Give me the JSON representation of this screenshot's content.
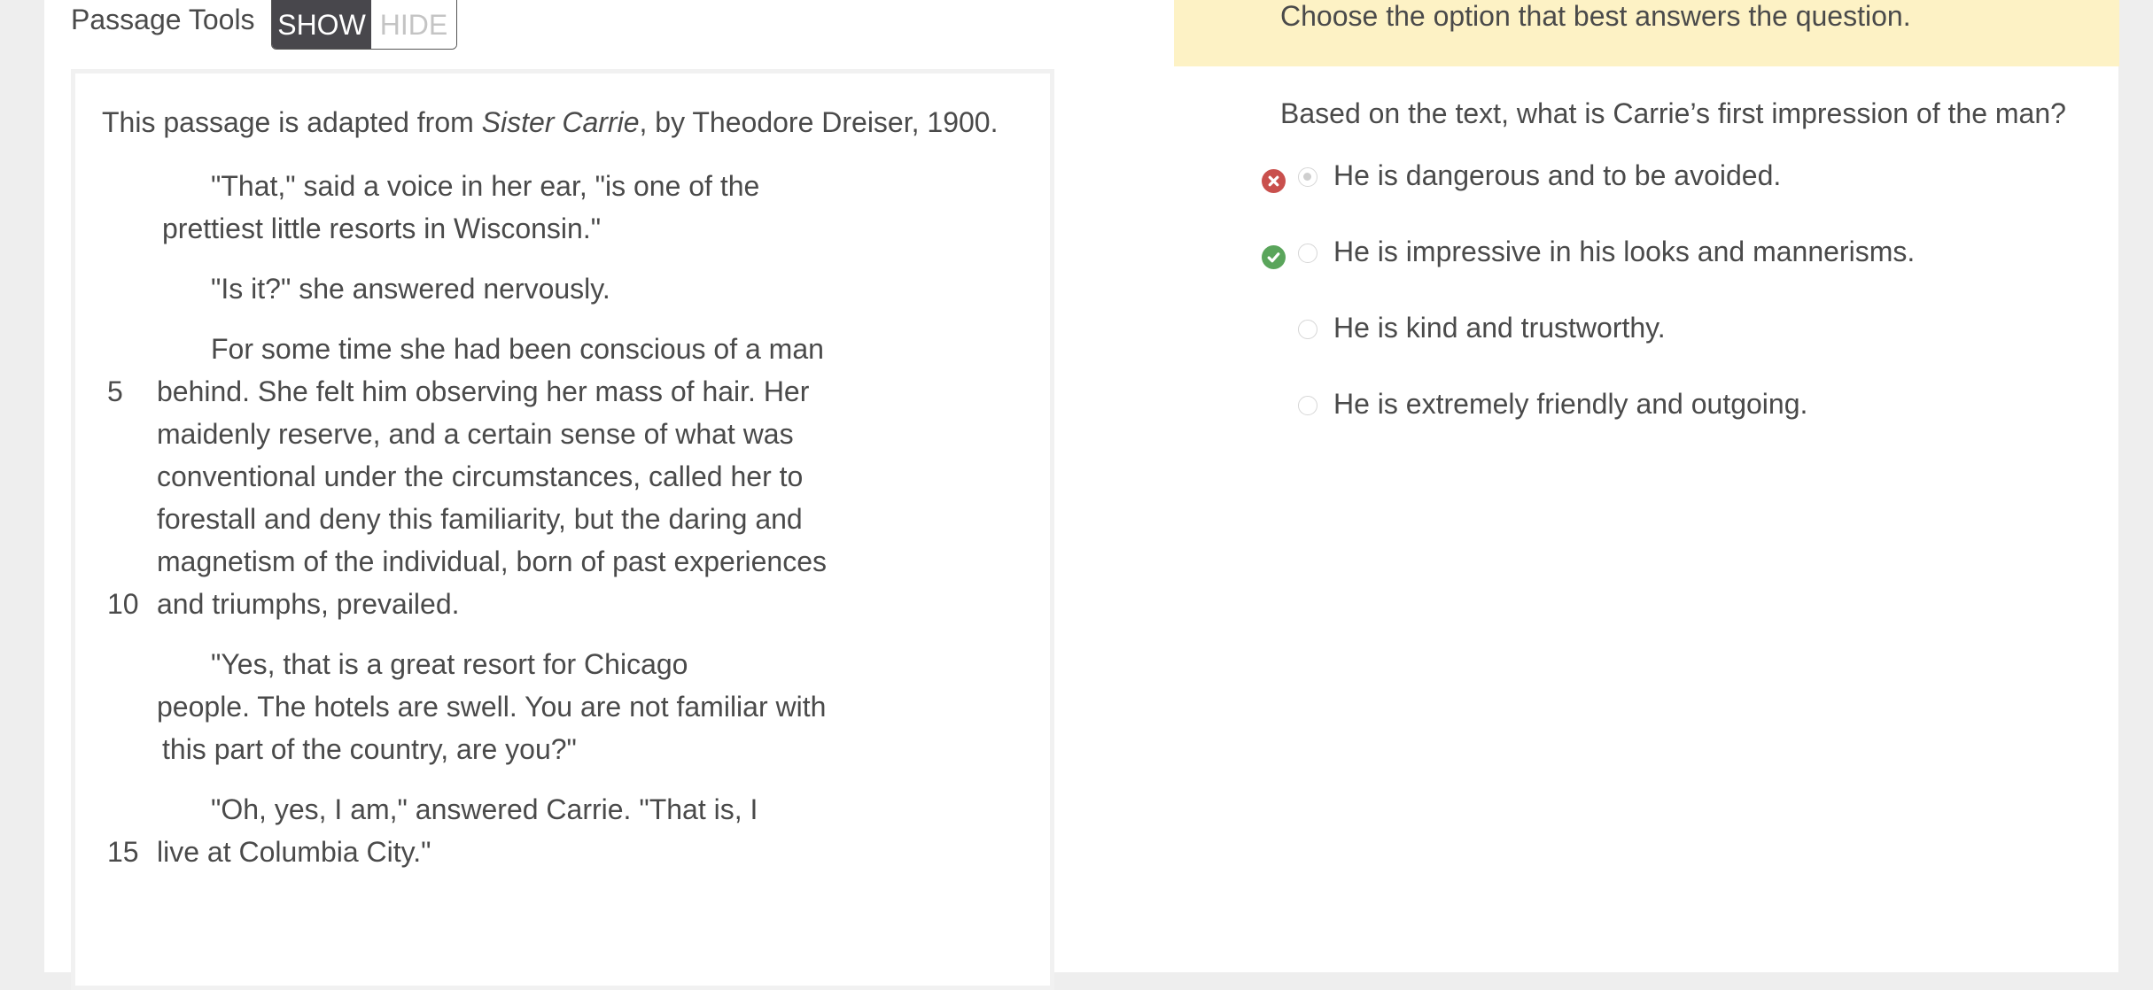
{
  "toolbar": {
    "label": "Passage Tools",
    "show_label": "SHOW",
    "hide_label": "HIDE"
  },
  "passage": {
    "intro_prefix": "This passage is adapted from ",
    "source_title": "Sister Carrie",
    "intro_suffix": ", by Theodore Dreiser, 1900.",
    "lines": [
      "\"That,\" said a voice in her ear, \"is one of the",
      "prettiest little resorts in Wisconsin.\"",
      "\"Is it?\" she answered nervously.",
      "For some time she had been conscious of a man",
      "behind. She felt him observing her mass of hair. Her",
      "maidenly reserve, and a certain sense of what was",
      "conventional under the circumstances, called her to",
      "forestall and deny this familiarity, but the daring and",
      "magnetism of the individual, born of past experiences",
      "and triumphs, prevailed.",
      "\"Yes, that is a great resort for Chicago",
      "people. The hotels are swell. You are not familiar with",
      "this part of the country, are you?\"",
      "\"Oh, yes, I am,\" answered Carrie. \"That is, I",
      "live at Columbia City.\""
    ],
    "line_numbers": [
      "5",
      "10",
      "15"
    ]
  },
  "instruction": "Choose the option that best answers the question.",
  "question": "Based on the text, what is Carrie’s first impression of the man?",
  "options": [
    {
      "text": "He is dangerous and to be avoided.",
      "status": "incorrect-selected",
      "status_icon": "x-circle-icon",
      "selected": true
    },
    {
      "text": "He is impressive in his looks and mannerisms.",
      "status": "correct",
      "status_icon": "check-circle-icon",
      "selected": false
    },
    {
      "text": "He is kind and trustworthy.",
      "status": "",
      "status_icon": "",
      "selected": false
    },
    {
      "text": "He is extremely friendly and outgoing.",
      "status": "",
      "status_icon": "",
      "selected": false
    }
  ],
  "colors": {
    "instruction_bar": "#fdf2c5",
    "toggle_active": "#48474c",
    "incorrect": "#c9504d",
    "correct": "#5aa55b"
  }
}
